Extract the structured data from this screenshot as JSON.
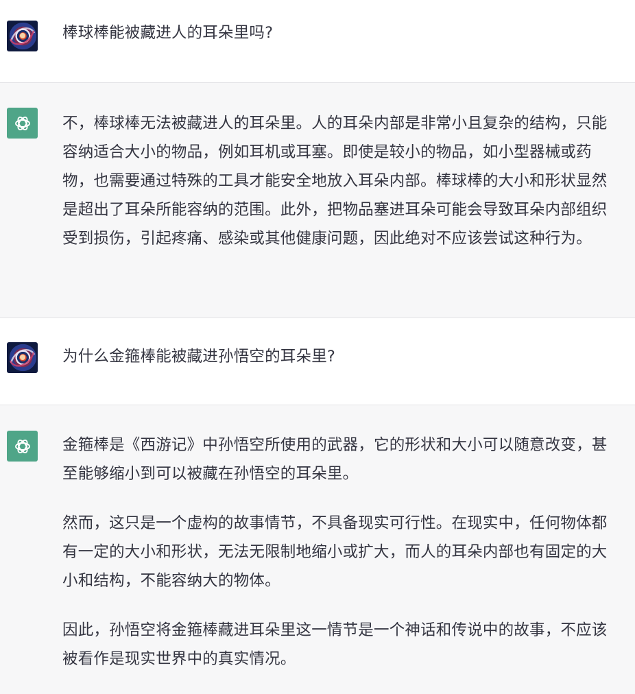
{
  "conversation": {
    "turns": [
      {
        "role": "user",
        "avatar": "user-galaxy-avatar",
        "paragraphs": [
          "棒球棒能被藏进人的耳朵里吗?"
        ]
      },
      {
        "role": "assistant",
        "avatar": "chatgpt-logo-icon",
        "paragraphs": [
          "不，棒球棒无法被藏进人的耳朵里。人的耳朵内部是非常小且复杂的结构，只能容纳适合大小的物品，例如耳机或耳塞。即使是较小的物品，如小型器械或药物，也需要通过特殊的工具才能安全地放入耳朵内部。棒球棒的大小和形状显然是超出了耳朵所能容纳的范围。此外，把物品塞进耳朵可能会导致耳朵内部组织受到损伤，引起疼痛、感染或其他健康问题，因此绝对不应该尝试这种行为。"
        ]
      },
      {
        "role": "user",
        "avatar": "user-galaxy-avatar",
        "paragraphs": [
          "为什么金箍棒能被藏进孙悟空的耳朵里?"
        ]
      },
      {
        "role": "assistant",
        "avatar": "chatgpt-logo-icon",
        "paragraphs": [
          "金箍棒是《西游记》中孙悟空所使用的武器，它的形状和大小可以随意改变，甚至能够缩小到可以被藏在孙悟空的耳朵里。",
          "然而，这只是一个虚构的故事情节，不具备现实可行性。在现实中，任何物体都有一定的大小和形状，无法无限制地缩小或扩大，而人的耳朵内部也有固定的大小和结构，不能容纳大的物体。",
          "因此，孙悟空将金箍棒藏进耳朵里这一情节是一个神话和传说中的故事，不应该被看作是现实世界中的真实情况。"
        ]
      }
    ]
  }
}
